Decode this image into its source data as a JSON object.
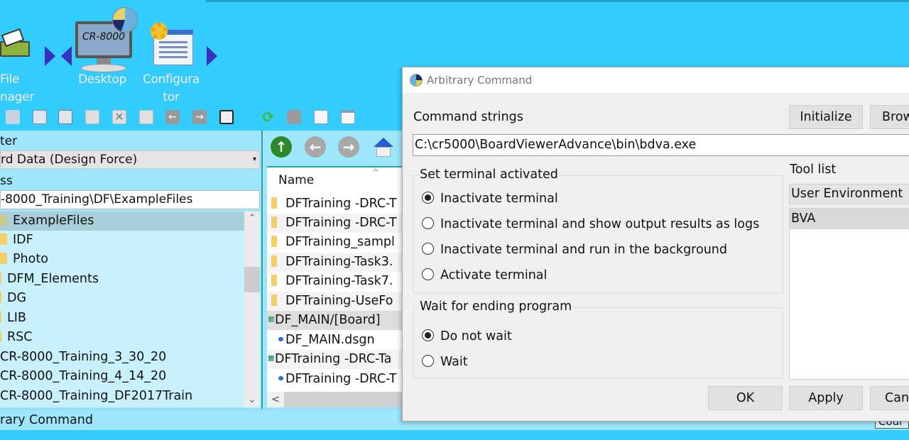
{
  "launcher": {
    "file_manager_label_1": "File",
    "file_manager_label_2": "nager",
    "desktop_label": "Desktop",
    "desktop_screen_text": "CR-8000",
    "configurator_label_1": "Configura",
    "configurator_label_2": "tor"
  },
  "left_panel": {
    "filter_label": "ter",
    "filter_value": "rd Data (Design Force)",
    "address_label": "ss",
    "address_value": "-8000_Training\\DF\\ExampleFiles",
    "tree": [
      {
        "label": "ExampleFiles",
        "type": "folder",
        "selected": true
      },
      {
        "label": "IDF",
        "type": "folder"
      },
      {
        "label": "Photo",
        "type": "folder"
      },
      {
        "label": "DFM_Elements",
        "type": "folder"
      },
      {
        "label": "DG",
        "type": "folder"
      },
      {
        "label": "LIB",
        "type": "folder"
      },
      {
        "label": "RSC",
        "type": "folder"
      },
      {
        "label": "CR-8000_Training_3_30_20",
        "type": "folder"
      },
      {
        "label": "CR-8000_Training_4_14_20",
        "type": "folder"
      },
      {
        "label": "CR-8000_Training_DF2017Train",
        "type": "folder"
      }
    ]
  },
  "file_list": {
    "column_name": "Name",
    "rows": [
      {
        "label": "DFTraining -DRC-T",
        "type": "folder"
      },
      {
        "label": "DFTraining -DRC-T",
        "type": "folder"
      },
      {
        "label": "DFTraining_sampl",
        "type": "folder"
      },
      {
        "label": "DFTraining-Task3.",
        "type": "folder"
      },
      {
        "label": "DFTraining-Task7.",
        "type": "folder"
      },
      {
        "label": "DFTraining-UseFo",
        "type": "folder"
      },
      {
        "label": "DF_MAIN/[Board]",
        "type": "board"
      },
      {
        "label": "DF_MAIN.dsgn",
        "type": "design"
      },
      {
        "label": "DFTraining -DRC-Ta",
        "type": "board"
      },
      {
        "label": "DFTraining -DRC-T",
        "type": "design"
      }
    ]
  },
  "status_bar": {
    "text": "rary Command",
    "right_sliver": "Cour"
  },
  "dialog": {
    "title": "Arbitrary Command",
    "command_strings_label": "Command strings",
    "initialize_button": "Initialize",
    "browse_button": "Brow",
    "command_value": "C:\\cr5000\\BoardViewerAdvance\\bin\\bdva.exe",
    "terminal_group": {
      "title": "Set terminal activated",
      "options": [
        {
          "label": "Inactivate terminal",
          "checked": true
        },
        {
          "label": "Inactivate terminal and show output results as logs",
          "checked": false
        },
        {
          "label": "Inactivate terminal and run in the background",
          "checked": false
        },
        {
          "label": "Activate terminal",
          "checked": false
        }
      ]
    },
    "wait_group": {
      "title": "Wait for ending program",
      "options": [
        {
          "label": "Do not wait",
          "checked": true
        },
        {
          "label": "Wait",
          "checked": false
        }
      ]
    },
    "tool_list_label": "Tool list",
    "tool_list_selected": "User Environment",
    "tool_list_items": [
      "BVA"
    ],
    "ok_button": "OK",
    "apply_button": "Apply",
    "cancel_button": "Can"
  }
}
